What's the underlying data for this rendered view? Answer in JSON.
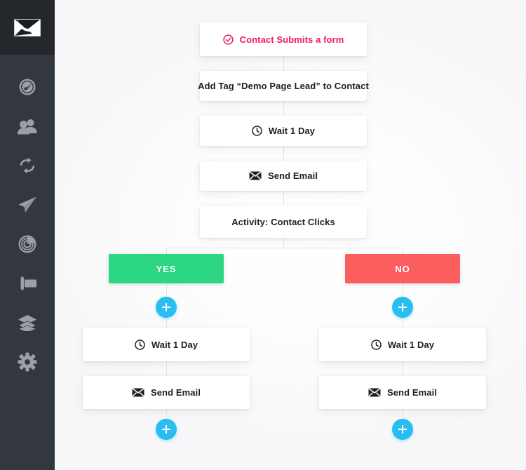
{
  "app": {
    "logo_name": "envelope-logo",
    "sidebar_bg": "#32383e",
    "logo_bg": "#23272b",
    "canvas_bg": "#fafafb"
  },
  "sidebar": {
    "items": [
      {
        "name": "dashboard",
        "icon": "gauge-icon"
      },
      {
        "name": "contacts",
        "icon": "people-icon"
      },
      {
        "name": "automations",
        "icon": "loop-arrows-icon"
      },
      {
        "name": "campaigns",
        "icon": "paper-plane-icon"
      },
      {
        "name": "reports",
        "icon": "pie-chart-icon"
      },
      {
        "name": "forms",
        "icon": "form-icon"
      },
      {
        "name": "lists",
        "icon": "layers-icon"
      },
      {
        "name": "settings",
        "icon": "gear-icon"
      }
    ]
  },
  "colors": {
    "pink": "#f4176b",
    "green": "#2dd782",
    "red": "#fb5e5e",
    "blue": "#29bdf2",
    "line": "#e3e5e8",
    "text": "#1c1f23"
  },
  "flow": {
    "main_steps": [
      {
        "label": "Contact Submits a form",
        "icon": "check-circle-icon",
        "type": "trigger"
      },
      {
        "label": "Add Tag “Demo Page Lead” to Contact",
        "icon": "none",
        "type": "action"
      },
      {
        "label": "Wait 1 Day",
        "icon": "clock-icon",
        "type": "action"
      },
      {
        "label": "Send Email",
        "icon": "envelope-icon",
        "type": "action"
      },
      {
        "label": "Activity: Contact Clicks",
        "icon": "none",
        "type": "condition"
      }
    ],
    "branches": [
      {
        "name": "yes",
        "label": "YES",
        "color": "#2dd782",
        "steps": [
          {
            "label": "Wait 1 Day",
            "icon": "clock-icon"
          },
          {
            "label": "Send Email",
            "icon": "envelope-icon"
          }
        ],
        "add_buttons": [
          "add-step-top",
          "add-step-bottom"
        ]
      },
      {
        "name": "no",
        "label": "NO",
        "color": "#fb5e5e",
        "steps": [
          {
            "label": "Wait 1 Day",
            "icon": "clock-icon"
          },
          {
            "label": "Send Email",
            "icon": "envelope-icon"
          }
        ],
        "add_buttons": [
          "add-step-top",
          "add-step-bottom"
        ]
      }
    ],
    "plus_symbol": "+"
  }
}
